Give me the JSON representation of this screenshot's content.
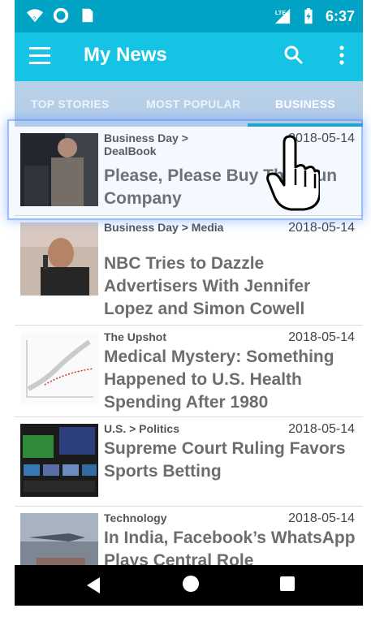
{
  "status_bar": {
    "time": "6:37",
    "network": "LTE"
  },
  "app_bar": {
    "title": "My News",
    "menu_icon": "hamburger-menu-icon",
    "search_icon": "search-icon",
    "more_icon": "more-vert-icon"
  },
  "tabs": [
    {
      "label": "TOP STORIES"
    },
    {
      "label": "MOST POPULAR"
    },
    {
      "label": "BUSINESS"
    }
  ],
  "articles": [
    {
      "section": "Business Day > DealBook",
      "date": "2018-05-14",
      "headline": "Please, Please Buy This Gun Company"
    },
    {
      "section": "Business Day > Media",
      "date": "2018-05-14",
      "headline": "NBC Tries to Dazzle Advertisers With Jennifer Lopez and Simon Cowell"
    },
    {
      "section": "The Upshot",
      "date": "2018-05-14",
      "headline": "Medical Mystery: Something Happened to U.S. Health Spending After 1980"
    },
    {
      "section": "U.S. > Politics",
      "date": "2018-05-14",
      "headline": "Supreme Court Ruling Favors Sports Betting"
    },
    {
      "section": "Technology",
      "date": "2018-05-14",
      "headline": "In India, Facebook’s WhatsApp Plays Central Role"
    }
  ],
  "colors": {
    "status_bar": "#00a3c4",
    "app_bar": "#15c4e5",
    "tab_bar": "#b7cfe7",
    "indicator": "#1aa4c8"
  }
}
